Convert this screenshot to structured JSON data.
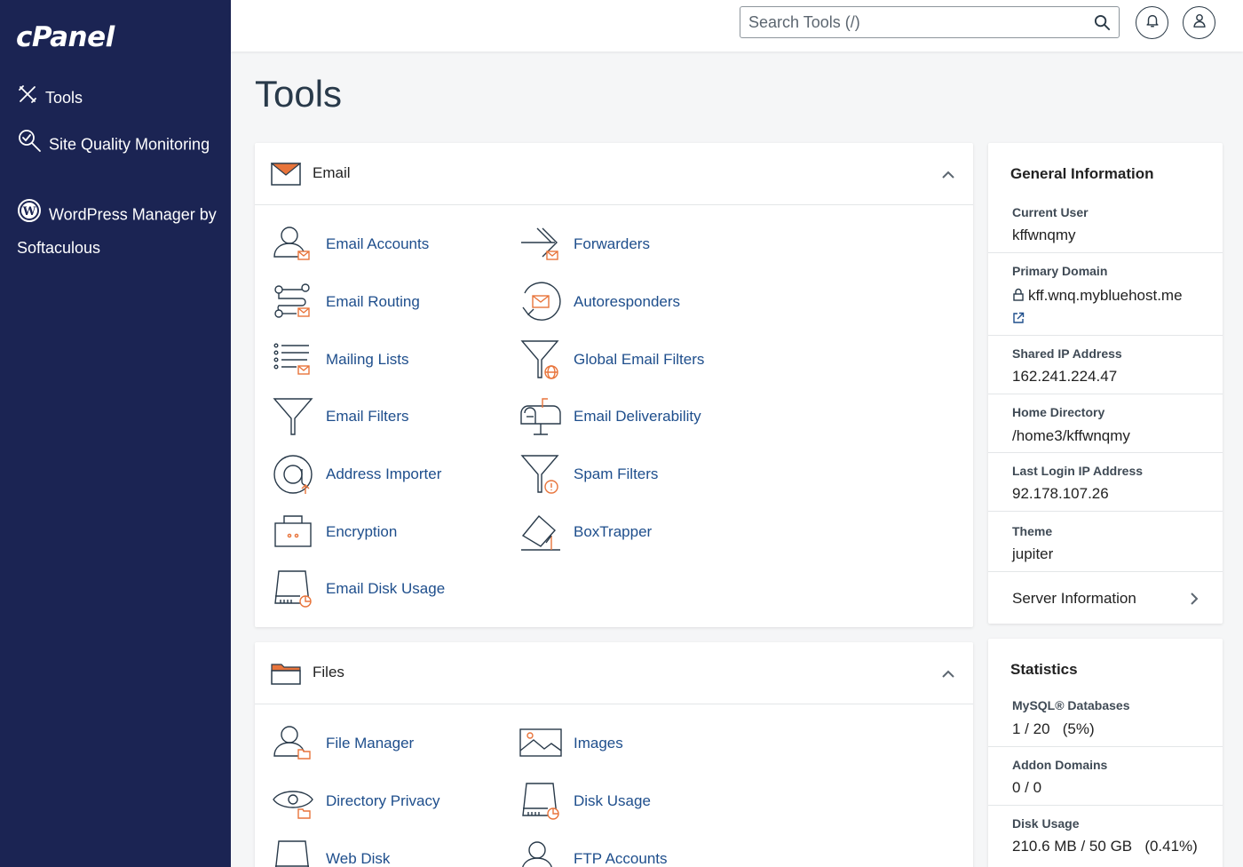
{
  "brand": {
    "logo_text": "cPanel"
  },
  "sidebar": {
    "items": [
      {
        "label": "Tools",
        "icon": "tools-icon"
      },
      {
        "label": "Site Quality Monitoring",
        "icon": "site-quality-icon"
      },
      {
        "label": "WordPress Manager by Softaculous",
        "icon": "wordpress-icon"
      }
    ]
  },
  "header": {
    "search_placeholder": "Search Tools (/)",
    "search_value": ""
  },
  "page": {
    "title": "Tools"
  },
  "email_section": {
    "title": "Email",
    "tools": [
      {
        "label": "Email Accounts",
        "icon": "email-accounts-icon"
      },
      {
        "label": "Forwarders",
        "icon": "forwarders-icon"
      },
      {
        "label": "Email Routing",
        "icon": "email-routing-icon"
      },
      {
        "label": "Autoresponders",
        "icon": "autoresponders-icon"
      },
      {
        "label": "Mailing Lists",
        "icon": "mailing-lists-icon"
      },
      {
        "label": "Global Email Filters",
        "icon": "global-email-filters-icon"
      },
      {
        "label": "Email Filters",
        "icon": "email-filters-icon"
      },
      {
        "label": "Email Deliverability",
        "icon": "email-deliverability-icon"
      },
      {
        "label": "Address Importer",
        "icon": "address-importer-icon"
      },
      {
        "label": "Spam Filters",
        "icon": "spam-filters-icon"
      },
      {
        "label": "Encryption",
        "icon": "encryption-icon"
      },
      {
        "label": "BoxTrapper",
        "icon": "boxtrapper-icon"
      },
      {
        "label": "Email Disk Usage",
        "icon": "email-disk-usage-icon"
      }
    ]
  },
  "files_section": {
    "title": "Files",
    "tools": [
      {
        "label": "File Manager",
        "icon": "file-manager-icon"
      },
      {
        "label": "Images",
        "icon": "images-icon"
      },
      {
        "label": "Directory Privacy",
        "icon": "directory-privacy-icon"
      },
      {
        "label": "Disk Usage",
        "icon": "disk-usage-icon"
      },
      {
        "label": "Web Disk",
        "icon": "web-disk-icon"
      },
      {
        "label": "FTP Accounts",
        "icon": "ftp-accounts-icon"
      }
    ]
  },
  "general_info": {
    "title": "General Information",
    "current_user_label": "Current User",
    "current_user": "kffwnqmy",
    "primary_domain_label": "Primary Domain",
    "primary_domain": "kff.wnq.mybluehost.me",
    "shared_ip_label": "Shared IP Address",
    "shared_ip": "162.241.224.47",
    "home_dir_label": "Home Directory",
    "home_dir": "/home3/kffwnqmy",
    "last_login_label": "Last Login IP Address",
    "last_login": "92.178.107.26",
    "theme_label": "Theme",
    "theme": "jupiter",
    "server_info_link": "Server Information"
  },
  "statistics": {
    "title": "Statistics",
    "mysql_label": "MySQL® Databases",
    "mysql_value": "1 / 20",
    "mysql_pct": "(5%)",
    "addon_label": "Addon Domains",
    "addon_value": "0 / 0",
    "disk_label": "Disk Usage",
    "disk_value": "210.6 MB / 50 GB",
    "disk_pct": "(0.41%)"
  },
  "colors": {
    "sidebar_bg": "#1b2453",
    "link": "#1e4e8c",
    "accent": "#e8743b"
  }
}
